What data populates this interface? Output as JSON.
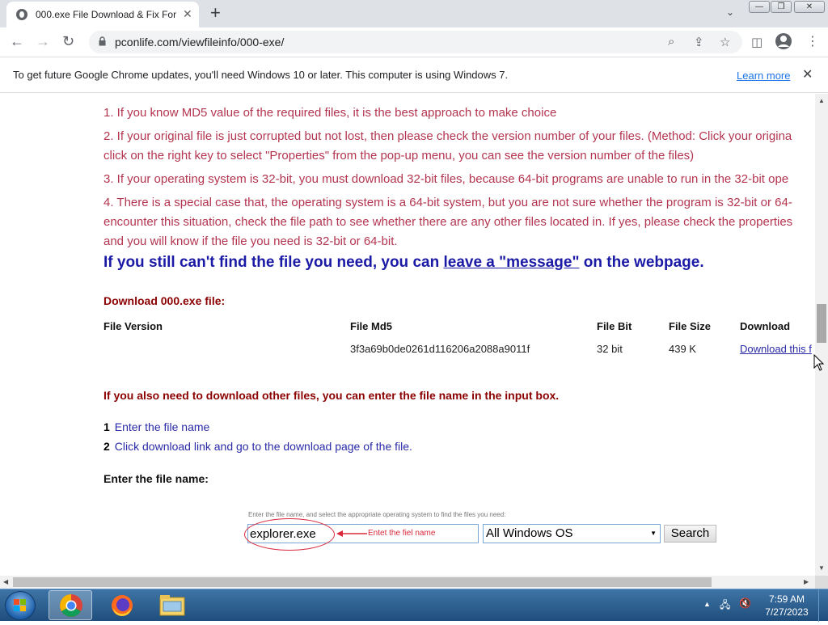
{
  "browser": {
    "tab_title": "000.exe File Download & Fix For",
    "url": "pconlife.com/viewfileinfo/000-exe/",
    "infobar_text": "To get future Google Chrome updates, you'll need Windows 10 or later. This computer is using Windows 7.",
    "learn_more": "Learn more"
  },
  "content": {
    "tips": [
      {
        "line1": "1.  If you know MD5 value of the required files, it is the best approach to make choice"
      },
      {
        "line1": "2.  If your original file is just corrupted but not lost, then please check the version number of your files. (Method: Click your origina",
        "line2": "click on the right key to select \"Properties\" from the pop-up menu, you can see the version number of the files)"
      },
      {
        "line1": "3.  If your operating system is 32-bit, you must download 32-bit files, because 64-bit programs are unable to run in the 32-bit ope"
      },
      {
        "line1": "4.  There is a special case that, the operating system is a 64-bit system, but you are not sure whether the program is 32-bit or 64-",
        "line2": "encounter this situation, check the file path to see whether there are any other files located in. If yes, please check the properties",
        "line3": "and you will know if the file you need is 32-bit or 64-bit."
      }
    ],
    "headline_pre": "If you still can't find the file you need, you can ",
    "headline_link": "leave a \"message\"",
    "headline_post": " on the webpage.",
    "download_heading": "Download 000.exe file:",
    "table": {
      "headers": [
        "File Version",
        "File Md5",
        "File Bit",
        "File Size",
        "Download"
      ],
      "row": {
        "version": "",
        "md5": "3f3a69b0de0261d116206a2088a9011f",
        "bit": "32 bit",
        "size": "439 K",
        "download": "Download this f"
      }
    },
    "other_files_text": "If you also need to download other files, you can enter the file name in the input box.",
    "steps": [
      {
        "num": "1",
        "label": "Enter the file name"
      },
      {
        "num": "2",
        "label": "Click download link and go to the download page of the file."
      }
    ],
    "enter_label": "Enter the file name:",
    "search": {
      "hint": "Enter the file name, and select the appropriate operating system to find the files you need:",
      "input_value": "explorer.exe",
      "annotation": "Entet the fiel name",
      "os_selected": "All Windows OS",
      "button": "Search"
    }
  },
  "taskbar": {
    "time": "7:59 AM",
    "date": "7/27/2023"
  },
  "colors": {
    "tip_text": "#b3354f",
    "headline": "#1a1aa6",
    "annotation": "#d8283a"
  }
}
